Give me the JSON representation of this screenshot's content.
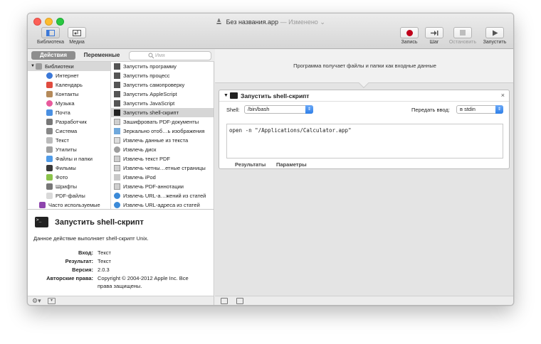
{
  "window": {
    "title": "Без названия.app",
    "edited": "— Изменено"
  },
  "toolbar": {
    "library": "Библиотека",
    "media": "Медиа",
    "record": "Запись",
    "step": "Шаг",
    "stop": "Остановить",
    "run": "Запустить"
  },
  "left_tabs": {
    "actions": "Действия",
    "variables": "Переменные",
    "search_placeholder": "Имя"
  },
  "library": {
    "root": "Библиотеки",
    "items": [
      {
        "label": "Интернет",
        "icon": "globe-icon",
        "color": "#3b78d8"
      },
      {
        "label": "Календарь",
        "icon": "calendar-icon",
        "color": "#e04b3f"
      },
      {
        "label": "Контакты",
        "icon": "contacts-icon",
        "color": "#b58a5a"
      },
      {
        "label": "Музыка",
        "icon": "music-icon",
        "color": "#e85a9c"
      },
      {
        "label": "Почта",
        "icon": "mail-icon",
        "color": "#4a90e2"
      },
      {
        "label": "Разработчик",
        "icon": "developer-icon",
        "color": "#777777"
      },
      {
        "label": "Система",
        "icon": "system-icon",
        "color": "#888888"
      },
      {
        "label": "Текст",
        "icon": "text-icon",
        "color": "#bbbbbb"
      },
      {
        "label": "Утилиты",
        "icon": "utilities-icon",
        "color": "#a0a0a0"
      },
      {
        "label": "Файлы и папки",
        "icon": "finder-icon",
        "color": "#4f9be8"
      },
      {
        "label": "Фильмы",
        "icon": "movies-icon",
        "color": "#3a3a3a"
      },
      {
        "label": "Фото",
        "icon": "photos-icon",
        "color": "#8bc34a"
      },
      {
        "label": "Шрифты",
        "icon": "fonts-icon",
        "color": "#777777"
      },
      {
        "label": "PDF-файлы",
        "icon": "pdf-icon",
        "color": "#d9d9d9"
      }
    ],
    "often_used": "Часто используемые"
  },
  "actions": [
    {
      "label": "Запустить программу",
      "icon": "automator-icon"
    },
    {
      "label": "Запустить процесс",
      "icon": "automator-icon"
    },
    {
      "label": "Запустить самопроверку",
      "icon": "automator-icon"
    },
    {
      "label": "Запустить AppleScript",
      "icon": "automator-icon"
    },
    {
      "label": "Запустить JavaScript",
      "icon": "automator-icon"
    },
    {
      "label": "Запустить shell-скрипт",
      "icon": "terminal-icon",
      "selected": true
    },
    {
      "label": "Зашифровать PDF-документы",
      "icon": "pdf-icon"
    },
    {
      "label": "Зеркально отоб…ь изображения",
      "icon": "image-icon"
    },
    {
      "label": "Извлечь данные из текста",
      "icon": "document-icon"
    },
    {
      "label": "Извлечь диск",
      "icon": "disk-icon"
    },
    {
      "label": "Извлечь текст PDF",
      "icon": "pdf-icon"
    },
    {
      "label": "Извлечь четны…етные страницы",
      "icon": "pdf-icon"
    },
    {
      "label": "Извлечь iPod",
      "icon": "ipod-icon"
    },
    {
      "label": "Извлечь PDF-аннотации",
      "icon": "pdf-icon"
    },
    {
      "label": "Извлечь URL-а…жений из статей",
      "icon": "safari-icon"
    },
    {
      "label": "Извлечь URL-адреса из статей",
      "icon": "safari-icon"
    }
  ],
  "description": {
    "title": "Запустить shell-скрипт",
    "text": "Данное действие выполняет shell-скрипт Unix.",
    "rows": [
      {
        "k": "Вход:",
        "v": "Текст"
      },
      {
        "k": "Результат:",
        "v": "Текст"
      },
      {
        "k": "Версия:",
        "v": "2.0.3"
      },
      {
        "k": "Авторские права:",
        "v": "Copyright © 2004-2012 Apple Inc. Все права защищены."
      }
    ]
  },
  "workflow": {
    "header": "Программа получает файлы и папки как входные данные",
    "card": {
      "title": "Запустить shell-скрипт",
      "shell_label": "Shell:",
      "shell_value": "/bin/bash",
      "pass_label": "Передать ввод:",
      "pass_value": "в stdin",
      "script": "open -n \"/Applications/Calculator.app\"",
      "tab_results": "Результаты",
      "tab_options": "Параметры"
    }
  },
  "colors": {
    "record": "#c0001a",
    "selected_row": "#d6d6d6",
    "popup_accent": "#2f7fe8"
  }
}
